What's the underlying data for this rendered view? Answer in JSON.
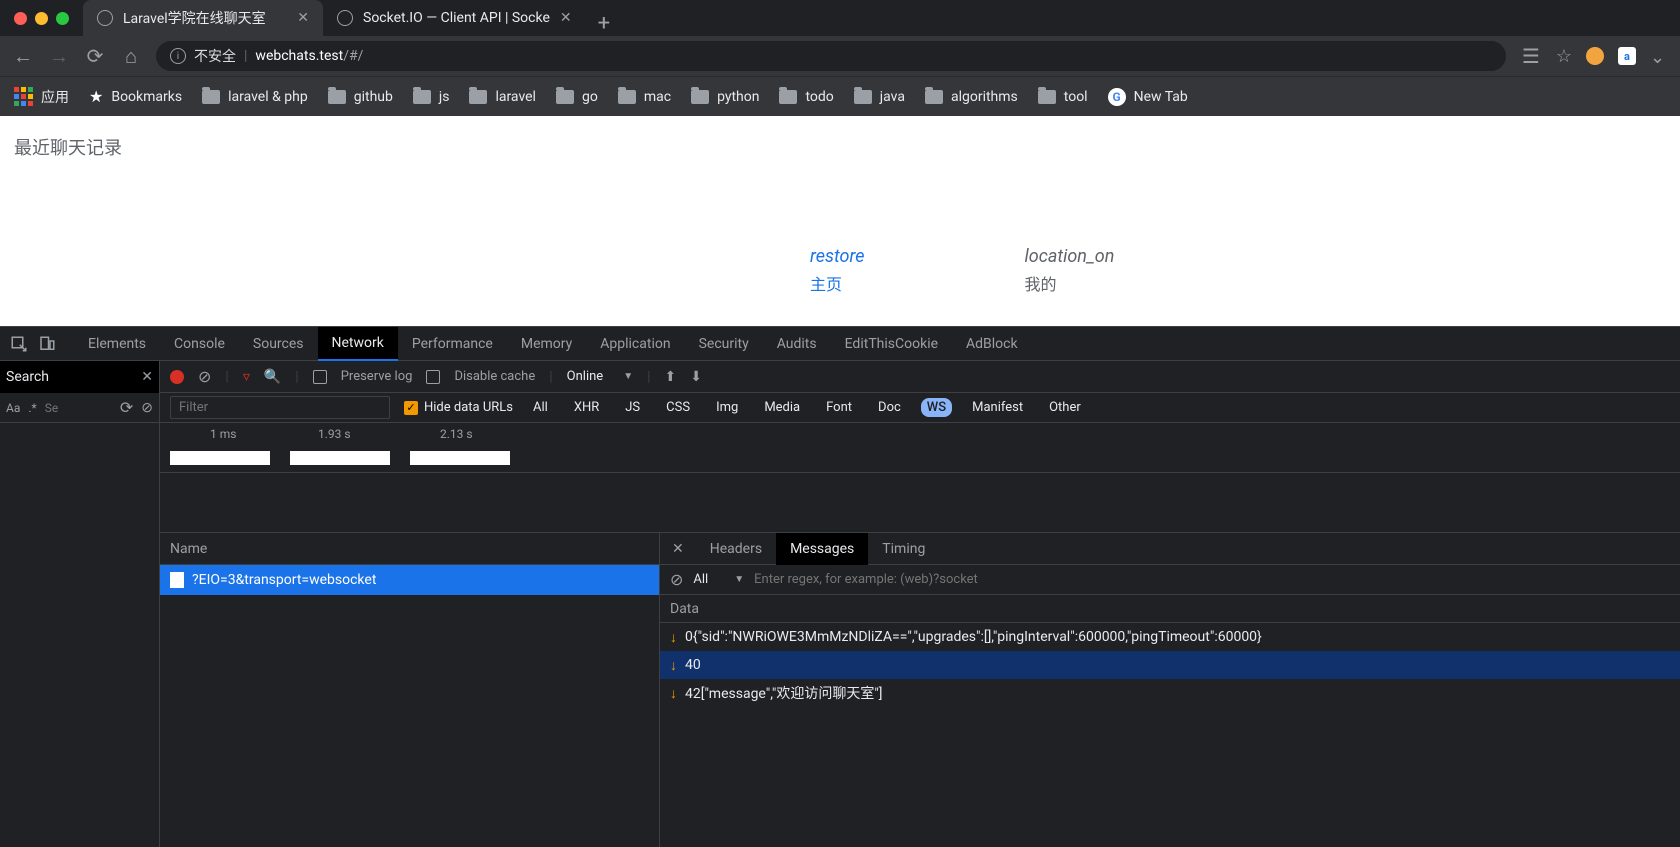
{
  "browser": {
    "tabs": [
      {
        "title": "Laravel学院在线聊天室",
        "active": true
      },
      {
        "title": "Socket.IO — Client API | Socke",
        "active": false
      }
    ],
    "address": {
      "insecure_label": "不安全",
      "host": "webchats.test",
      "path": "/#/"
    },
    "bookmarks": [
      {
        "label": "应用",
        "kind": "apps"
      },
      {
        "label": "Bookmarks",
        "kind": "star"
      },
      {
        "label": "laravel & php",
        "kind": "folder"
      },
      {
        "label": "github",
        "kind": "folder"
      },
      {
        "label": "js",
        "kind": "folder"
      },
      {
        "label": "laravel",
        "kind": "folder"
      },
      {
        "label": "go",
        "kind": "folder"
      },
      {
        "label": "mac",
        "kind": "folder"
      },
      {
        "label": "python",
        "kind": "folder"
      },
      {
        "label": "todo",
        "kind": "folder"
      },
      {
        "label": "java",
        "kind": "folder"
      },
      {
        "label": "algorithms",
        "kind": "folder"
      },
      {
        "label": "tool",
        "kind": "folder"
      },
      {
        "label": "New Tab",
        "kind": "g"
      }
    ]
  },
  "page": {
    "heading": "最近聊天记录",
    "nav": [
      {
        "icon": "restore",
        "label": "主页",
        "active": true
      },
      {
        "icon": "location_on",
        "label": "我的",
        "active": false
      }
    ]
  },
  "devtools": {
    "panels": [
      "Elements",
      "Console",
      "Sources",
      "Network",
      "Performance",
      "Memory",
      "Application",
      "Security",
      "Audits",
      "EditThisCookie",
      "AdBlock"
    ],
    "active_panel": "Network",
    "search": {
      "title": "Search",
      "placeholder": "Se"
    },
    "network": {
      "toolbar": {
        "preserve_log": "Preserve log",
        "disable_cache": "Disable cache",
        "throttle": "Online"
      },
      "filter": {
        "placeholder": "Filter",
        "hide_data_urls": "Hide data URLs",
        "types": [
          "All",
          "XHR",
          "JS",
          "CSS",
          "Img",
          "Media",
          "Font",
          "Doc",
          "WS",
          "Manifest",
          "Other"
        ],
        "selected": "WS"
      },
      "timeline": {
        "ticks": [
          "1 ms",
          "1.93 s",
          "2.13 s"
        ]
      },
      "name_header": "Name",
      "requests": [
        {
          "name": "?EIO=3&transport=websocket",
          "selected": true
        }
      ],
      "detail": {
        "tabs": [
          "Headers",
          "Messages",
          "Timing"
        ],
        "active": "Messages",
        "msg_toolbar": {
          "filter": "All",
          "placeholder": "Enter regex, for example: (web)?socket"
        },
        "data_header": "Data",
        "messages": [
          {
            "dir": "down",
            "text": "0{\"sid\":\"NWRiOWE3MmMzNDliZA==\",\"upgrades\":[],\"pingInterval\":600000,\"pingTimeout\":60000}"
          },
          {
            "dir": "down",
            "text": "40",
            "hl": true
          },
          {
            "dir": "down",
            "text": "42[\"message\",\"欢迎访问聊天室\"]"
          }
        ]
      }
    }
  }
}
